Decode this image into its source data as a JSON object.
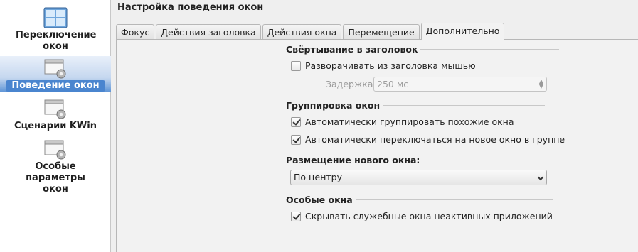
{
  "sidebar": {
    "items": [
      {
        "label": "Переключение окон",
        "icon": "window-switch-icon"
      },
      {
        "label": "Поведение окон",
        "icon": "window-behavior-icon",
        "selected": true
      },
      {
        "label": "Сценарии KWin",
        "icon": "kwin-scripts-icon"
      },
      {
        "label": "Особые параметры окон",
        "icon": "window-rules-icon"
      }
    ]
  },
  "header": {
    "title": "Настройка поведения окон"
  },
  "tabs": [
    {
      "label": "Фокус"
    },
    {
      "label": "Действия заголовка"
    },
    {
      "label": "Действия окна"
    },
    {
      "label": "Перемещение"
    },
    {
      "label": "Дополнительно",
      "active": true
    }
  ],
  "shading": {
    "title": "Свёртывание в заголовок",
    "hover_unshade": {
      "label": "Разворачивать из заголовка мышью",
      "checked": false
    },
    "delay_label": "Задержка:",
    "delay_value": "250 мс"
  },
  "grouping": {
    "title": "Группировка окон",
    "auto_group": {
      "label": "Автоматически группировать похожие окна",
      "checked": true
    },
    "auto_switch": {
      "label": "Автоматически переключаться на новое окно в группе",
      "checked": true
    }
  },
  "placement": {
    "title": "Размещение нового окна:",
    "value": "По центру"
  },
  "special": {
    "title": "Особые окна",
    "hide_utility": {
      "label": "Скрывать служебные окна неактивных приложений",
      "checked": true
    }
  },
  "colors": {
    "selection": "#4a85cf",
    "background": "#efefef"
  }
}
